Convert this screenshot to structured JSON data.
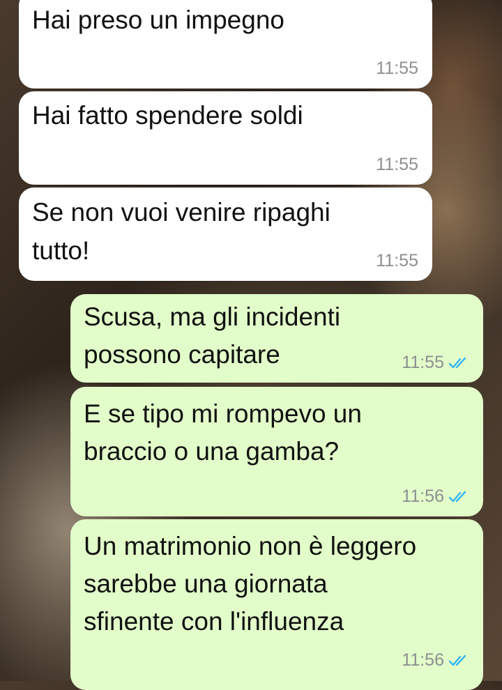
{
  "chat": {
    "messages": [
      {
        "direction": "in",
        "text": "Hai preso un impegno",
        "time": "11:55"
      },
      {
        "direction": "in",
        "text": "Hai fatto spendere soldi",
        "time": "11:55"
      },
      {
        "direction": "in",
        "text": "Se non vuoi venire ripaghi\ntutto!",
        "time": "11:55"
      },
      {
        "direction": "out",
        "text": "Scusa, ma gli incidenti\npossono capitare",
        "time": "11:55",
        "status": "read"
      },
      {
        "direction": "out",
        "text": "E se tipo mi rompevo un\nbraccio o una gamba?",
        "time": "11:56",
        "status": "read"
      },
      {
        "direction": "out",
        "text": "Un matrimonio non è leggero\nsarebbe una giornata\nsfinente con l'influenza",
        "time": "11:56",
        "status": "read"
      }
    ]
  },
  "colors": {
    "incoming_bubble": "#ffffff",
    "outgoing_bubble": "#e2fdc9",
    "timestamp": "#8c8f91",
    "read_ticks": "#34b7f1"
  },
  "icons": {
    "read_receipt": "double-check-icon"
  }
}
